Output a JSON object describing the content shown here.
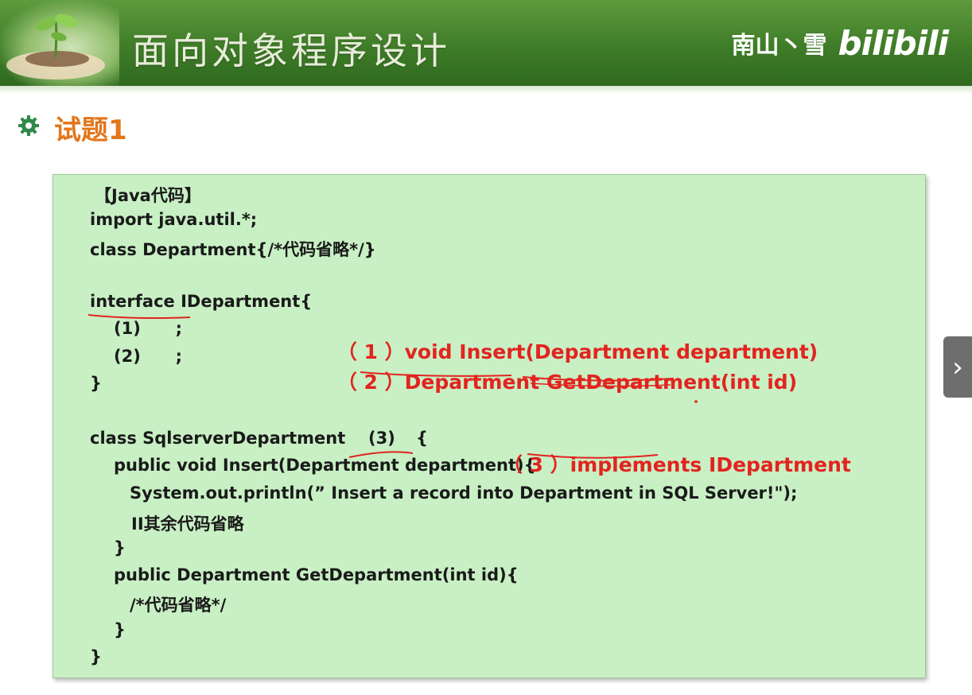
{
  "header": {
    "title": "面向对象程序设计",
    "watermark_name": "南山丶雪",
    "watermark_logo": "bilibili"
  },
  "section": {
    "title": "试题1",
    "bullet_icon": "gear-icon"
  },
  "code": {
    "lines": [
      "【Java代码】",
      "import java.util.*;",
      "class Department{/*代码省略*/}",
      "interface IDepartment{",
      "(1)      ;",
      "(2)      ;",
      "}",
      "class SqlserverDepartment",
      "(3)",
      "{",
      "public void Insert(Department department){",
      "System.out.println(” Insert a record into Department in SQL Server!\");",
      "II其余代码省略",
      "}",
      "public Department GetDepartment(int id){",
      "/*代码省略*/",
      "}",
      "}"
    ]
  },
  "answers": [
    {
      "num": "（ 1 ）",
      "text": "void Insert(Department department)"
    },
    {
      "num": "（ 2 ）",
      "text": "Department GetDepartment(int id)"
    },
    {
      "num": "（ 3 ）",
      "text": "implements IDepartment"
    }
  ],
  "nav": {
    "next_icon": "chevron-right-icon",
    "next_glyph": "›"
  },
  "colors": {
    "banner": "#3f7c28",
    "section_title": "#e2761c",
    "code_bg": "#c8f0c4",
    "answer": "#e3231f"
  }
}
